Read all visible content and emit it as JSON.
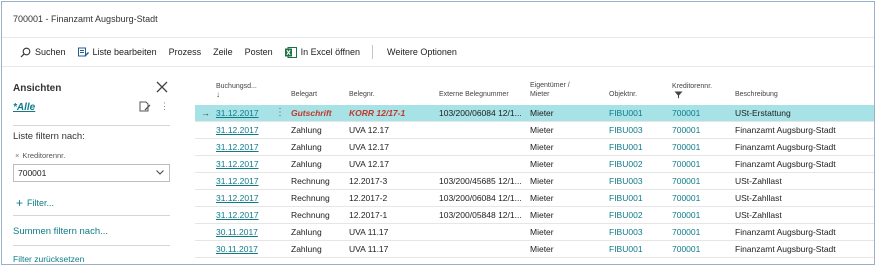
{
  "title": "700001 - Finanzamt Augsburg-Stadt",
  "actions": {
    "search": "Suchen",
    "edit_list": "Liste bearbeiten",
    "process": "Prozess",
    "row": "Zeile",
    "post": "Posten",
    "excel": "In Excel öffnen",
    "more": "Weitere Optionen"
  },
  "pane": {
    "heading": "Ansichten",
    "view_all": "*Alle",
    "filter_heading": "Liste filtern nach:",
    "filter_field": "Kreditorennr.",
    "filter_value": "700001",
    "add_filter": "Filter...",
    "totals": "Summen filtern nach...",
    "reset": "Filter zurücksetzen"
  },
  "columns": {
    "date_line1": "Buchungsd...",
    "date_sort": "↓",
    "doc_type": "Belegart",
    "doc_no": "Belegnr.",
    "ext_doc": "Externe Belegnummer",
    "owner_line1": "Eigentümer /",
    "owner_line2": "Mieter",
    "object": "Objektnr.",
    "vendor_line1": "Kreditorennr.",
    "description": "Beschreibung"
  },
  "colors": {
    "accent": "#0f7b89",
    "selected_row": "#a6e2e6",
    "credit_memo": "#c0392b"
  },
  "rows": [
    {
      "date": "31.12.2017",
      "type": "Gutschrift",
      "no": "KORR 12/17-1",
      "ext": "103/200/06084 12/1...",
      "owner": "Mieter",
      "object": "FIBU001",
      "vendor": "700001",
      "desc": "USt-Erstattung",
      "selected": true
    },
    {
      "date": "31.12.2017",
      "type": "Zahlung",
      "no": "UVA 12.17",
      "ext": "",
      "owner": "Mieter",
      "object": "FIBU003",
      "vendor": "700001",
      "desc": "Finanzamt Augsburg-Stadt"
    },
    {
      "date": "31.12.2017",
      "type": "Zahlung",
      "no": "UVA 12.17",
      "ext": "",
      "owner": "Mieter",
      "object": "FIBU001",
      "vendor": "700001",
      "desc": "Finanzamt Augsburg-Stadt"
    },
    {
      "date": "31.12.2017",
      "type": "Zahlung",
      "no": "UVA 12.17",
      "ext": "",
      "owner": "Mieter",
      "object": "FIBU002",
      "vendor": "700001",
      "desc": "Finanzamt Augsburg-Stadt"
    },
    {
      "date": "31.12.2017",
      "type": "Rechnung",
      "no": "12.2017-3",
      "ext": "103/200/45685 12/1...",
      "owner": "Mieter",
      "object": "FIBU003",
      "vendor": "700001",
      "desc": "USt-Zahllast"
    },
    {
      "date": "31.12.2017",
      "type": "Rechnung",
      "no": "12.2017-2",
      "ext": "103/200/06084 12/1...",
      "owner": "Mieter",
      "object": "FIBU001",
      "vendor": "700001",
      "desc": "USt-Zahllast"
    },
    {
      "date": "31.12.2017",
      "type": "Rechnung",
      "no": "12.2017-1",
      "ext": "103/200/05848 12/1...",
      "owner": "Mieter",
      "object": "FIBU002",
      "vendor": "700001",
      "desc": "USt-Zahllast"
    },
    {
      "date": "30.11.2017",
      "type": "Zahlung",
      "no": "UVA 11.17",
      "ext": "",
      "owner": "Mieter",
      "object": "FIBU003",
      "vendor": "700001",
      "desc": "Finanzamt Augsburg-Stadt"
    },
    {
      "date": "30.11.2017",
      "type": "Zahlung",
      "no": "UVA 11.17",
      "ext": "",
      "owner": "Mieter",
      "object": "FIBU001",
      "vendor": "700001",
      "desc": "Finanzamt Augsburg-Stadt"
    }
  ]
}
